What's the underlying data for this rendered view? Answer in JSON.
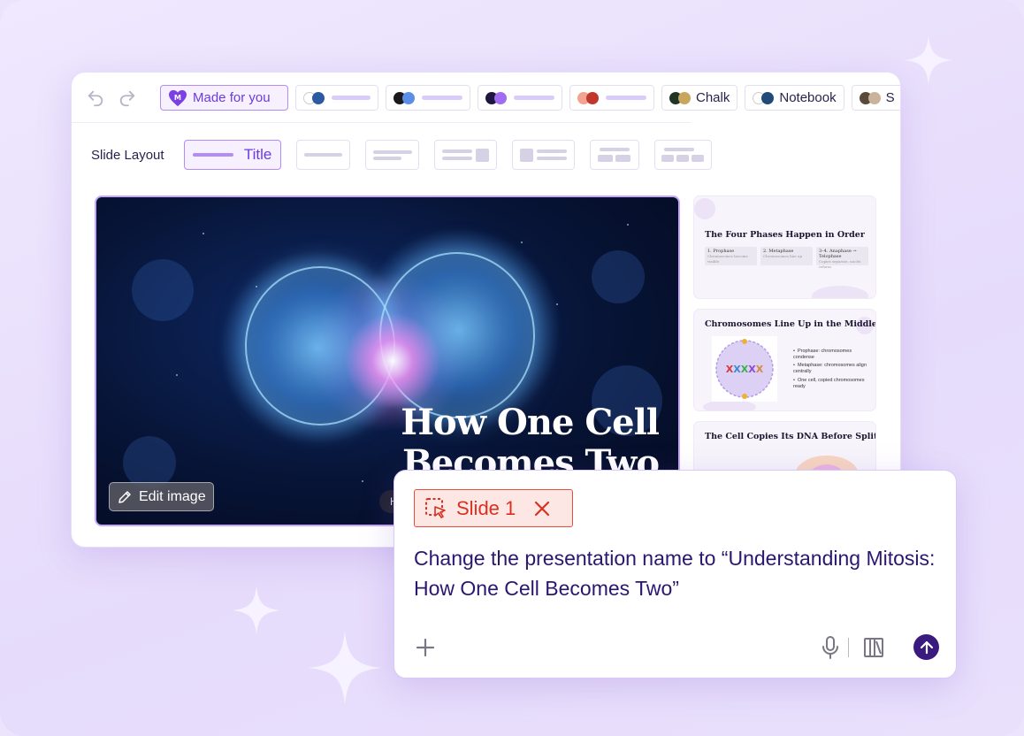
{
  "toolbar": {
    "themes": [
      {
        "label": "Made for you",
        "active": true
      },
      {
        "label": "",
        "colors": [
          "#ffffff",
          "#2c5aa0"
        ]
      },
      {
        "label": "",
        "colors": [
          "#1a1a1a",
          "#5b8ee6"
        ]
      },
      {
        "label": "",
        "colors": [
          "#1f1640",
          "#a06cf0"
        ]
      },
      {
        "label": "",
        "colors": [
          "#f2a490",
          "#c0382b"
        ]
      },
      {
        "label": "Chalk",
        "colors": [
          "#1f3526",
          "#c9a65e"
        ]
      },
      {
        "label": "Notebook",
        "colors": [
          "#ffffff",
          "#1f4a7a"
        ]
      },
      {
        "label": "S",
        "colors": [
          "#5a4a3a",
          "#c9b39a"
        ]
      }
    ]
  },
  "layout": {
    "label": "Slide Layout",
    "options": [
      {
        "label": "Title",
        "active": true
      },
      {
        "label": ""
      },
      {
        "label": ""
      },
      {
        "label": ""
      },
      {
        "label": ""
      },
      {
        "label": ""
      },
      {
        "label": ""
      }
    ]
  },
  "slide": {
    "title": "How One Cell Becomes Two",
    "author_initial": "H",
    "edit_image_label": "Edit image"
  },
  "thumbnails": [
    {
      "title": "The Four Phases Happen in Order",
      "phases": [
        {
          "name": "1. Prophase",
          "desc": "Chromosomes become visible"
        },
        {
          "name": "2. Metaphase",
          "desc": "Chromosomes line up"
        },
        {
          "name": "3–4. Anaphase → Telophase",
          "desc": "Copies separate, nuclei reform"
        }
      ]
    },
    {
      "title": "Chromosomes Line Up in the Middle",
      "bullets": [
        "Prophase: chromosomes condense",
        "Metaphase: chromosomes align centrally",
        "One cell, copied chromosomes ready"
      ]
    },
    {
      "title": "The Cell Copies Its DNA Before Splitting"
    }
  ],
  "prompt": {
    "tag_label": "Slide 1",
    "text": "Change the presentation name to “Understanding Mitosis: How One Cell Becomes Two”"
  },
  "colors": {
    "accent": "#6d3ae0",
    "tag_red": "#d9301f",
    "prompt_text": "#2b1670",
    "send_button": "#3a1a7e"
  }
}
